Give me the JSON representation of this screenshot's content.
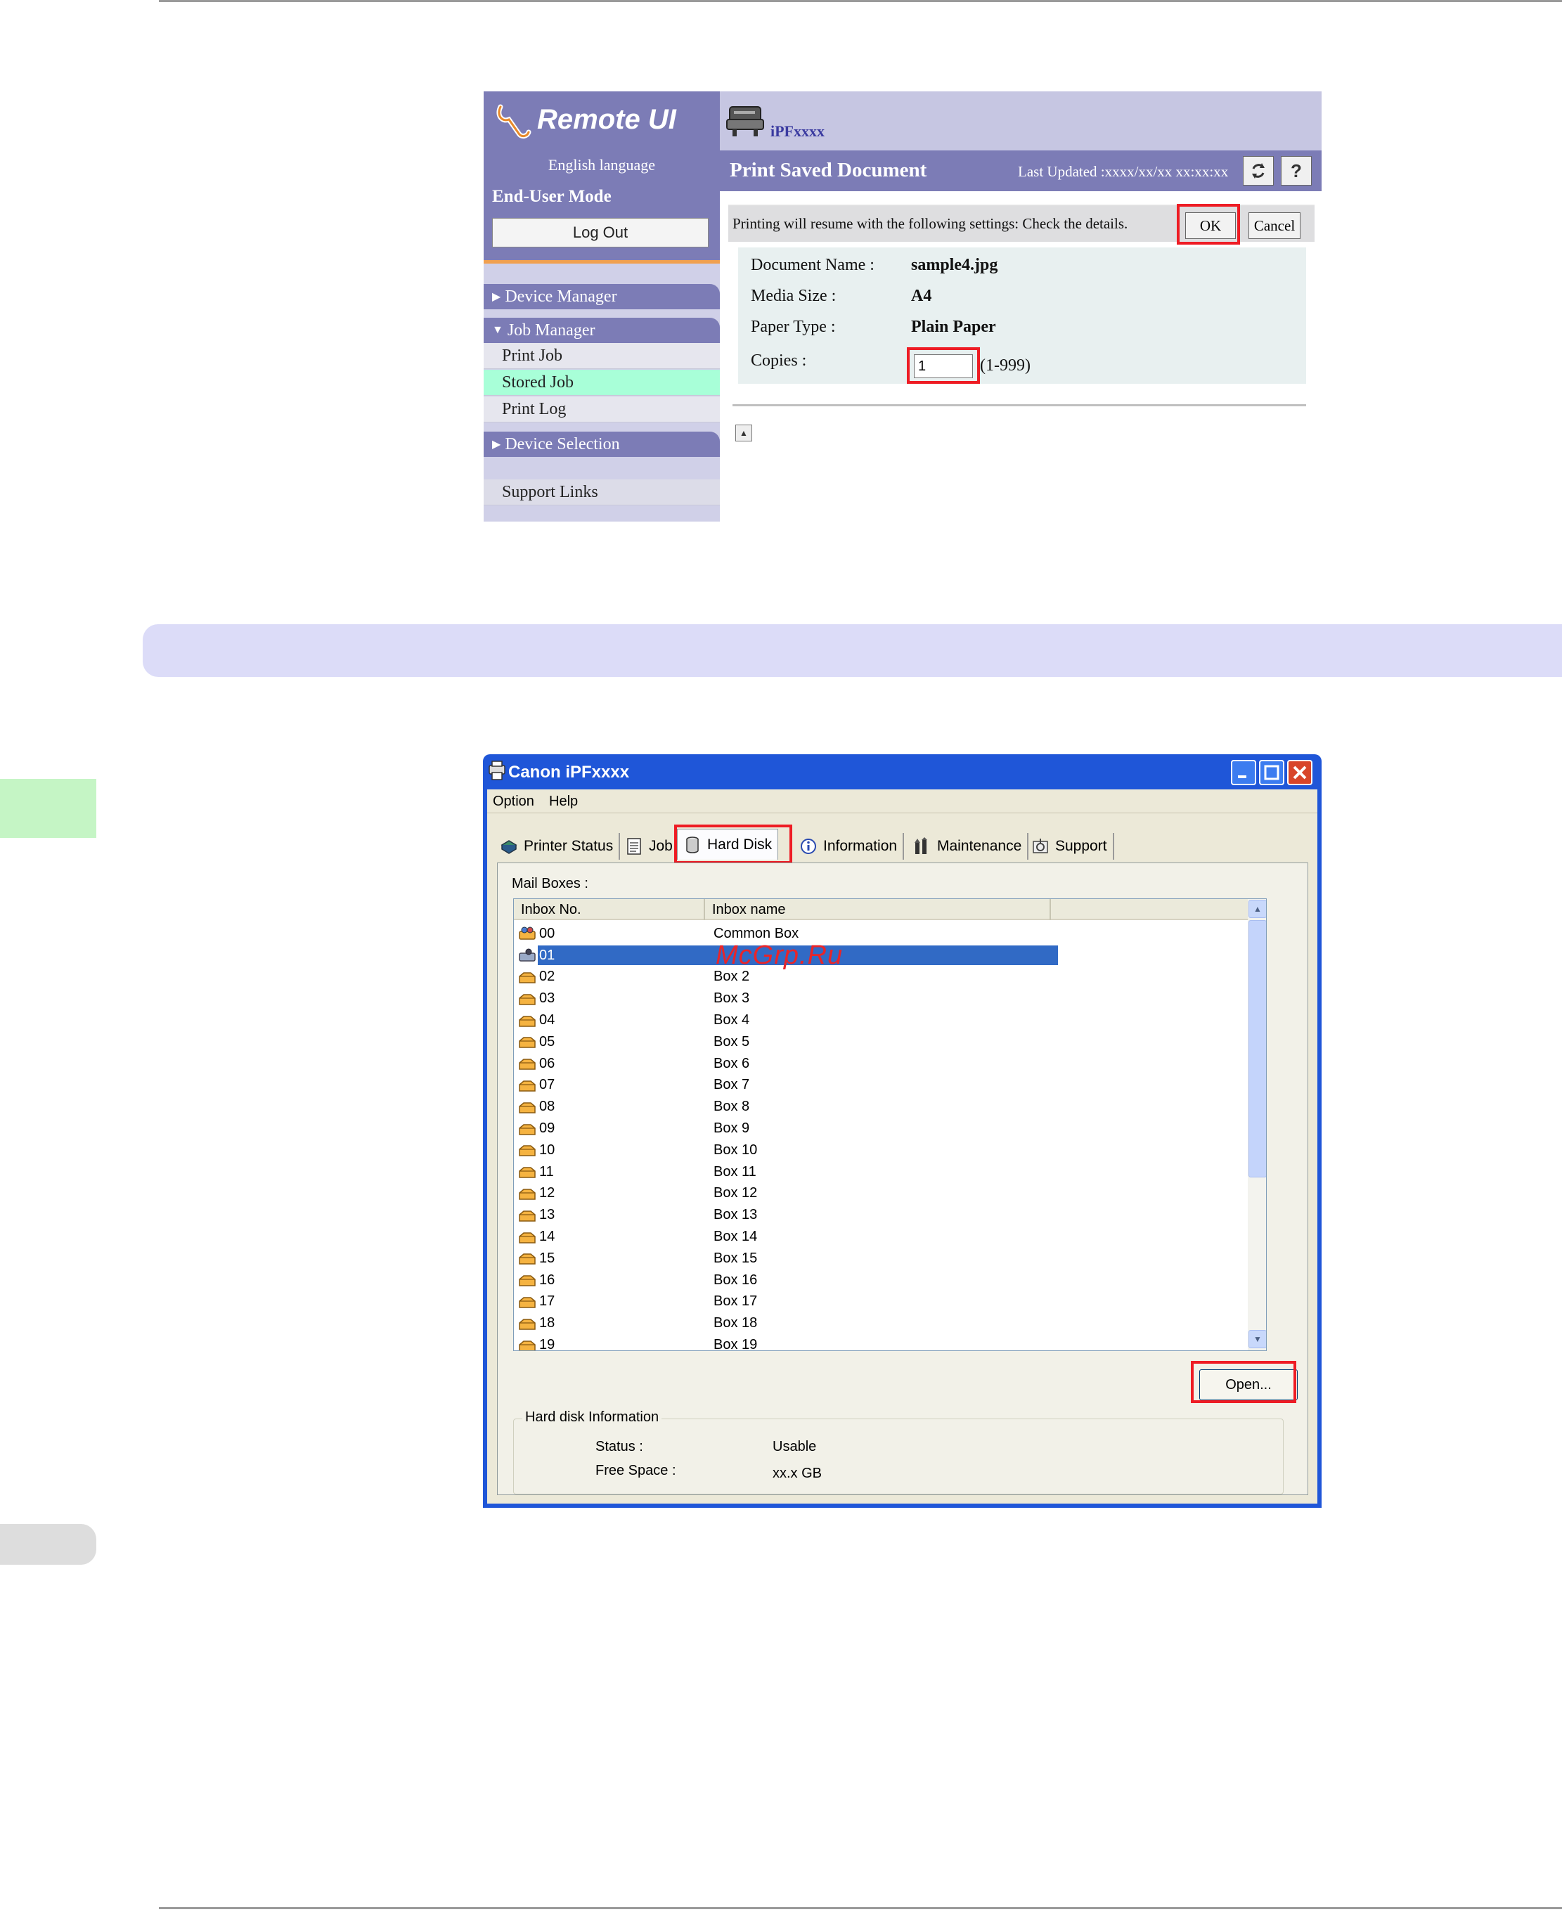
{
  "remote_ui": {
    "logo": "Remote UI",
    "language": "English language",
    "mode": "End-User Mode",
    "logout_label": "Log Out",
    "nav": {
      "device_manager": "Device Manager",
      "job_manager": "Job Manager",
      "print_job": "Print Job",
      "stored_job": "Stored Job",
      "print_log": "Print Log",
      "device_selection": "Device Selection",
      "support_links": "Support Links"
    },
    "printer_name": "iPFxxxx",
    "page_title": "Print Saved Document",
    "last_updated": "Last Updated :xxxx/xx/xx xx:xx:xx",
    "refresh_icon": "refresh-icon",
    "help_label": "?",
    "message": "Printing will resume with the following settings: Check the details.",
    "ok_label": "OK",
    "cancel_label": "Cancel",
    "details": [
      {
        "label": "Document Name :",
        "value": "sample4.jpg"
      },
      {
        "label": "Media Size :",
        "value": "A4"
      },
      {
        "label": "Paper Type :",
        "value": "Plain Paper"
      }
    ],
    "copies_label": "Copies :",
    "copies_value": "1",
    "copies_range": "(1-999)"
  },
  "dialog": {
    "title": "Canon iPFxxxx",
    "menu": [
      "Option",
      "Help"
    ],
    "tabs": {
      "printer_status": "Printer Status",
      "job": "Job",
      "hard_disk": "Hard Disk",
      "information": "Information",
      "maintenance": "Maintenance",
      "support": "Support"
    },
    "mail_boxes_label": "Mail Boxes :",
    "columns": [
      "Inbox No.",
      "Inbox name"
    ],
    "rows": [
      {
        "no": "00",
        "name": "Common Box"
      },
      {
        "no": "01",
        "name": ""
      },
      {
        "no": "02",
        "name": "Box 2"
      },
      {
        "no": "03",
        "name": "Box 3"
      },
      {
        "no": "04",
        "name": "Box 4"
      },
      {
        "no": "05",
        "name": "Box 5"
      },
      {
        "no": "06",
        "name": "Box 6"
      },
      {
        "no": "07",
        "name": "Box 7"
      },
      {
        "no": "08",
        "name": "Box 8"
      },
      {
        "no": "09",
        "name": "Box 9"
      },
      {
        "no": "10",
        "name": "Box 10"
      },
      {
        "no": "11",
        "name": "Box 11"
      },
      {
        "no": "12",
        "name": "Box 12"
      },
      {
        "no": "13",
        "name": "Box 13"
      },
      {
        "no": "14",
        "name": "Box 14"
      },
      {
        "no": "15",
        "name": "Box 15"
      },
      {
        "no": "16",
        "name": "Box 16"
      },
      {
        "no": "17",
        "name": "Box 17"
      },
      {
        "no": "18",
        "name": "Box 18"
      },
      {
        "no": "19",
        "name": "Box 19"
      }
    ],
    "selected_row": 1,
    "open_label": "Open...",
    "hd_info_title": "Hard disk Information",
    "status_label": "Status :",
    "status_value": "Usable",
    "free_space_label": "Free Space :",
    "free_space_value": "xx.x GB"
  },
  "watermark": "McGrp.Ru",
  "colors": {
    "highlight_red": "#ee1c24",
    "remote_ui_purple": "#7c7cb6",
    "selection_blue": "#316ac5",
    "xp_titlebar": "#1f56d8"
  }
}
